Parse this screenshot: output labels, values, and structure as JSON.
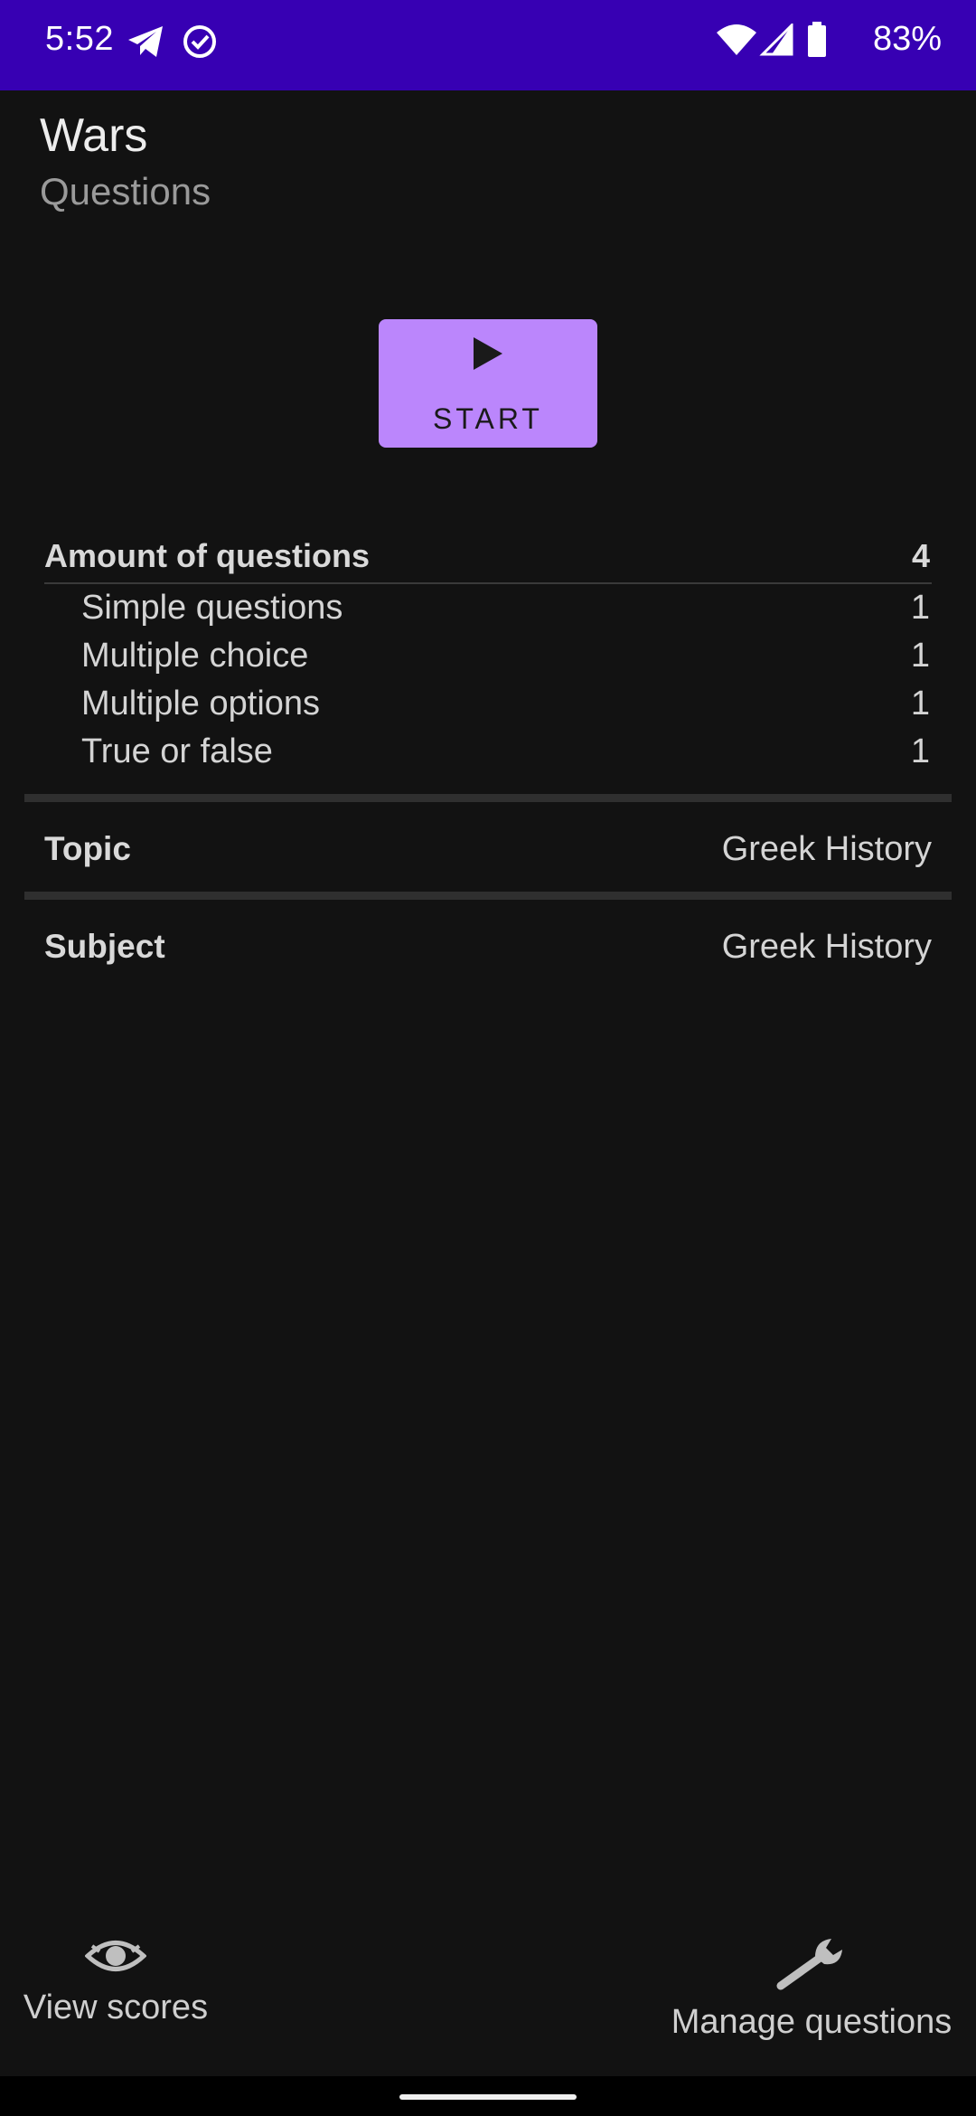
{
  "status_bar": {
    "time": "5:52",
    "battery": "83%",
    "icons": [
      "telegram-icon",
      "check-circle-icon",
      "wifi-icon",
      "signal-icon",
      "battery-icon"
    ],
    "background": "#3700b3"
  },
  "header": {
    "title": "Wars",
    "subtitle": "Questions"
  },
  "start_button": {
    "label": "START",
    "icon": "play-icon",
    "color": "#bb86fc"
  },
  "question_stats": {
    "total_label": "Amount of questions",
    "total_value": "4",
    "items": [
      {
        "label": "Simple questions",
        "value": "1"
      },
      {
        "label": "Multiple choice",
        "value": "1"
      },
      {
        "label": "Multiple options",
        "value": "1"
      },
      {
        "label": "True or false",
        "value": "1"
      }
    ]
  },
  "details": {
    "topic_label": "Topic",
    "topic_value": "Greek History",
    "subject_label": "Subject",
    "subject_value": "Greek History"
  },
  "bottom_actions": {
    "view_scores": {
      "label": "View scores",
      "icon": "eye-icon"
    },
    "manage_questions": {
      "label": "Manage questions",
      "icon": "wrench-icon"
    }
  }
}
